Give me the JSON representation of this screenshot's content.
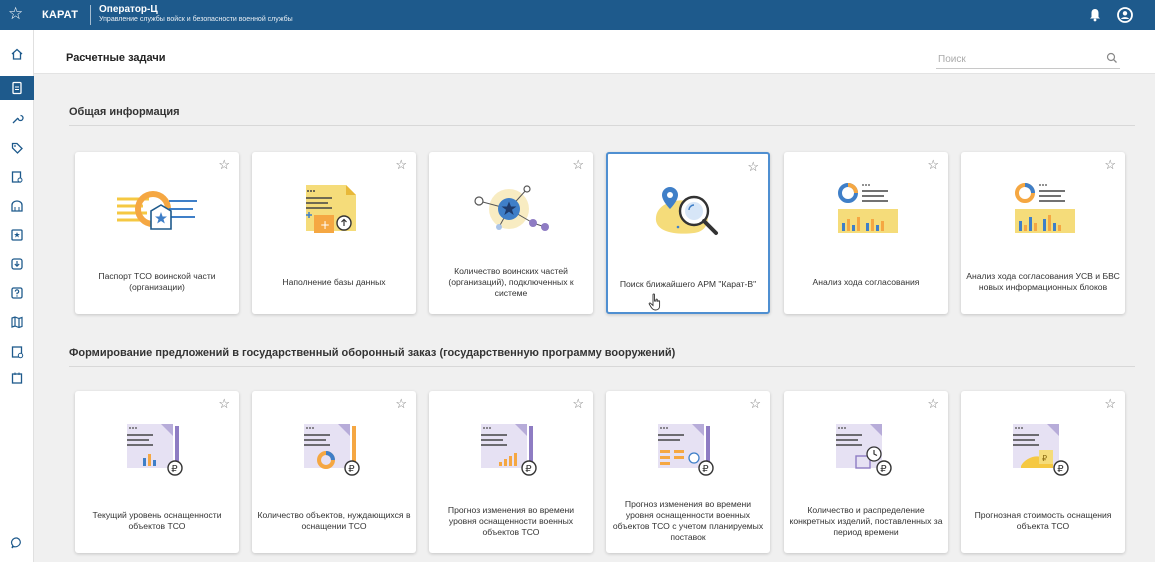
{
  "topbar": {
    "app_name": "КАРАТ",
    "title": "Оператор-Ц",
    "subtitle": "Управление службы войск и безопасности военной службы"
  },
  "sidebar": {
    "icons": [
      "home-icon",
      "document-icon",
      "wrench-icon",
      "tag-icon",
      "clipboard-user-icon",
      "museum-icon",
      "shield-star-icon",
      "download-icon",
      "question-icon",
      "map-icon",
      "checklist-icon",
      "calendar-icon",
      "chat-icon"
    ]
  },
  "header": {
    "title": "Расчетные задачи",
    "search_placeholder": "Поиск"
  },
  "sections": [
    {
      "title": "Общая информация",
      "cards": [
        {
          "label": "Паспорт ТСО воинской части (организации)",
          "icon": "passport-icon"
        },
        {
          "label": "Наполнение базы данных",
          "icon": "database-fill-icon"
        },
        {
          "label": "Количество воинских частей (организаций), подключенных к системе",
          "icon": "network-icon"
        },
        {
          "label": "Поиск ближайшего АРМ \"Карат-В\"",
          "icon": "location-search-icon"
        },
        {
          "label": "Анализ хода согласования",
          "icon": "analysis-chart-icon"
        },
        {
          "label": "Анализ хода согласования УСВ и БВС новых информационных блоков",
          "icon": "analysis-chart-icon"
        }
      ]
    },
    {
      "title": "Формирование предложений в государственный оборонный заказ (государственную программу вооружений)",
      "cards": [
        {
          "label": "Текущий уровень оснащенности объектов ТСО",
          "icon": "equipment-level-icon"
        },
        {
          "label": "Количество объектов, нуждающихся в оснащении ТСО",
          "icon": "objects-need-icon"
        },
        {
          "label": "Прогноз изменения во времени уровня оснащенности военных объектов ТСО",
          "icon": "forecast-icon"
        },
        {
          "label": "Прогноз изменения во времени уровня оснащенности военных объектов ТСО с учетом планируемых поставок",
          "icon": "forecast-delivery-icon"
        },
        {
          "label": "Количество и распределение конкретных изделий, поставленных за период времени",
          "icon": "distribution-icon"
        },
        {
          "label": "Прогнозная стоимость оснащения объекта ТСО",
          "icon": "cost-icon"
        }
      ]
    }
  ],
  "colors": {
    "primary": "#1e5a8c",
    "highlight_border": "#4f8fd1",
    "accent_yellow": "#f5c842",
    "accent_purple": "#8e7cc3",
    "accent_blue": "#3f7fc8"
  }
}
